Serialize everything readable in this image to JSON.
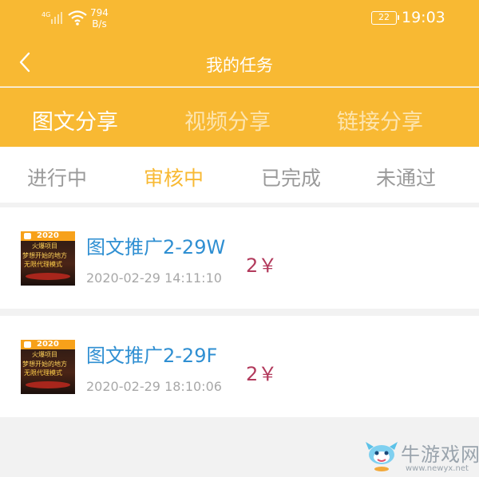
{
  "status_bar": {
    "signal_label": "4G",
    "speed_value": "794",
    "speed_unit": "B/s",
    "battery": "22",
    "time": "19:03"
  },
  "nav": {
    "title": "我的任务",
    "back_icon": "chevron-left-icon"
  },
  "type_tabs": [
    {
      "label": "图文分享",
      "active": true
    },
    {
      "label": "视频分享",
      "active": false
    },
    {
      "label": "链接分享",
      "active": false
    }
  ],
  "status_tabs": [
    {
      "label": "进行中",
      "active": false
    },
    {
      "label": "审核中",
      "active": true
    },
    {
      "label": "已完成",
      "active": false
    },
    {
      "label": "未通过",
      "active": false
    }
  ],
  "tasks": [
    {
      "title": "图文推广2-29W",
      "time": "2020-02-29 14:11:10",
      "reward": "2￥",
      "thumb": {
        "year": "2020",
        "line1": "火爆项目",
        "line2": "梦想开始的地方",
        "line3": "无限代理模式"
      }
    },
    {
      "title": "图文推广2-29F",
      "time": "2020-02-29 18:10:06",
      "reward": "2￥",
      "thumb": {
        "year": "2020",
        "line1": "火爆项目",
        "line2": "梦想开始的地方",
        "line3": "无限代理模式"
      }
    }
  ],
  "watermark": {
    "name": "牛游戏网",
    "url": "www.newyx.net"
  },
  "colors": {
    "brand": "#f8b933",
    "title_link": "#2f8fd2",
    "reward": "#b23a5c",
    "inactive_tab": "#9a9a9a"
  }
}
